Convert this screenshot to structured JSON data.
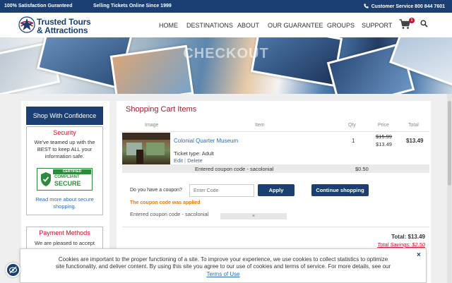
{
  "topbar": {
    "satisfaction": "100% Satisfaction Guranteed",
    "since": "Selling Tickets Online Since 1999",
    "customer_service": "Customer Service 800 844 7601"
  },
  "brand": {
    "line1": "Trusted Tours",
    "line2": "& Attractions",
    "colors": {
      "navy": "#1b3f72",
      "red": "#c8102e",
      "link": "#2a6bb3"
    }
  },
  "nav": {
    "items": [
      "HOME",
      "DESTINATIONS",
      "ABOUT",
      "OUR GUARANTEE",
      "GROUPS",
      "SUPPORT"
    ],
    "cart_count": "1"
  },
  "banner": {
    "title": "CHECKOUT"
  },
  "sidebar": {
    "header": "Shop With Confidence",
    "security": {
      "title": "Security",
      "lines": [
        "We've teamed up with the",
        "BEST to keep ALL your",
        "information safe."
      ],
      "badge_top": "CERTIFIED",
      "badge_mid": "COMPLIANT",
      "badge_main": "SECURE",
      "link_lines": [
        "Read more about secure",
        "shopping."
      ]
    },
    "payment": {
      "title": "Payment Methods",
      "text": "We are pleased to accept"
    }
  },
  "cart": {
    "title": "Shopping Cart Items",
    "headers": {
      "image": "Image",
      "item": "Item",
      "qty": "Qty",
      "price": "Price",
      "total": "Total"
    },
    "item": {
      "name": "Colonial Quarter Museum",
      "ticket_type": "Ticket type: Adult",
      "edit": "Edit",
      "separator": "|",
      "delete": "Delete",
      "qty": "1",
      "price_old": "$15.99",
      "price_new": "$13.49",
      "total": "$13.49"
    },
    "coupon_row": {
      "text": "Entered coupon code - sacolonial",
      "value": "$0.50"
    },
    "coupon": {
      "question": "Do you have a coupon?",
      "placeholder": "Enter Code",
      "apply": "Apply",
      "continue": "Continue shopping",
      "applied_msg": "The coupon code was applied",
      "entered": "Entered coupon code - sacolonial",
      "remove": "×"
    },
    "summary": {
      "total": "Total: $13.49",
      "savings": "Total Savings: $2.50"
    }
  },
  "cookie": {
    "line1": "Cookies are important to the proper functioning of a site. To improve your experience, we use cookies to collect statistics to optimize",
    "line2": "site functionality, and deliver content. By using this site you agree to our use of cookies and terms of service. For more details, see our",
    "terms": "Terms of Use",
    "close": "×"
  }
}
